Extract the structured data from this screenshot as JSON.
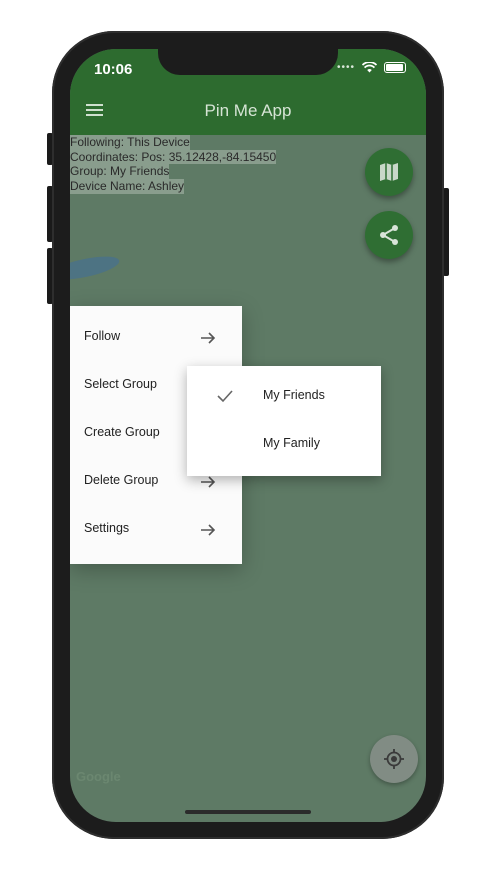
{
  "status_bar": {
    "time": "10:06"
  },
  "app_bar": {
    "title": "Pin Me App"
  },
  "info": {
    "following": "Following: This Device",
    "coordinates": "Coordinates: Pos: 35.12428,-84.15450",
    "group": "Group: My Friends",
    "device_name": "Device Name: Ashley"
  },
  "menu": {
    "items": [
      {
        "label": "Follow",
        "icon": "arrow-right-icon"
      },
      {
        "label": "Select Group",
        "icon": "arrow-right-icon"
      },
      {
        "label": "Create Group",
        "icon": "arrow-right-icon"
      },
      {
        "label": "Delete Group",
        "icon": "arrow-right-icon"
      },
      {
        "label": "Settings",
        "icon": "arrow-right-icon"
      }
    ]
  },
  "submenu": {
    "items": [
      {
        "label": "My Friends",
        "checked": true
      },
      {
        "label": "My Family",
        "checked": false
      }
    ]
  },
  "map": {
    "attribution": "Google"
  },
  "buttons": {
    "map_fab_icon": "map-icon",
    "share_fab_icon": "share-icon",
    "locate_icon": "my-location-icon"
  },
  "colors": {
    "app_bar": "#2d6b2f",
    "fab": "#2f6e33",
    "map_overlay": "#5e7a65"
  }
}
